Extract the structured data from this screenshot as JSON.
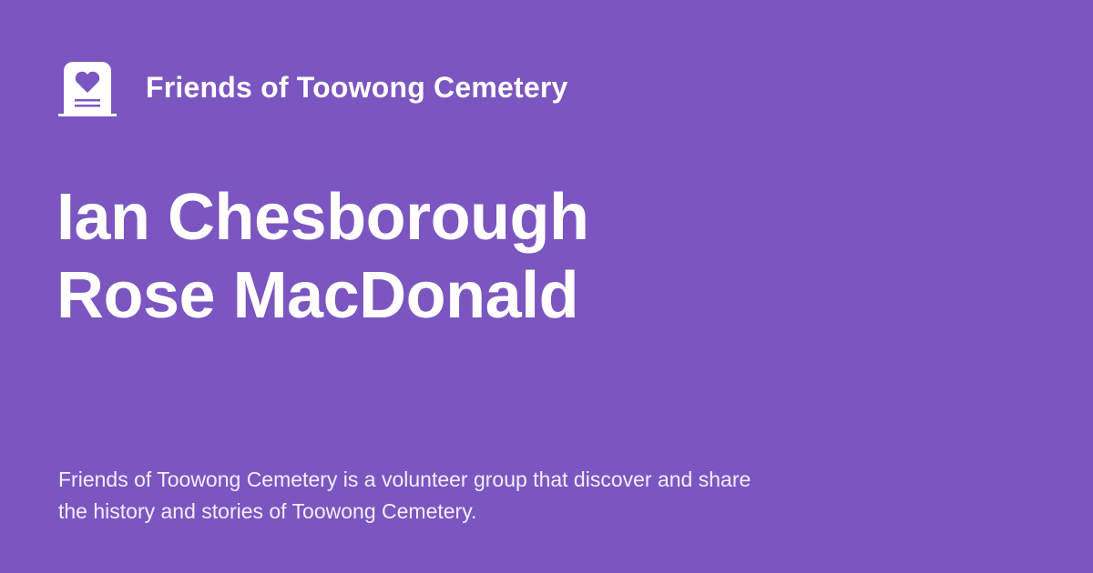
{
  "site": {
    "name": "Friends of Toowong Cemetery",
    "logo_icon": "headstone-heart-icon"
  },
  "title": {
    "line1": "Ian Chesborough",
    "line2": "Rose MacDonald"
  },
  "description": "Friends of Toowong Cemetery is a volunteer group that discover and share the history and stories of Toowong Cemetery.",
  "colors": {
    "background": "#7b56c0",
    "text": "#ffffff"
  }
}
